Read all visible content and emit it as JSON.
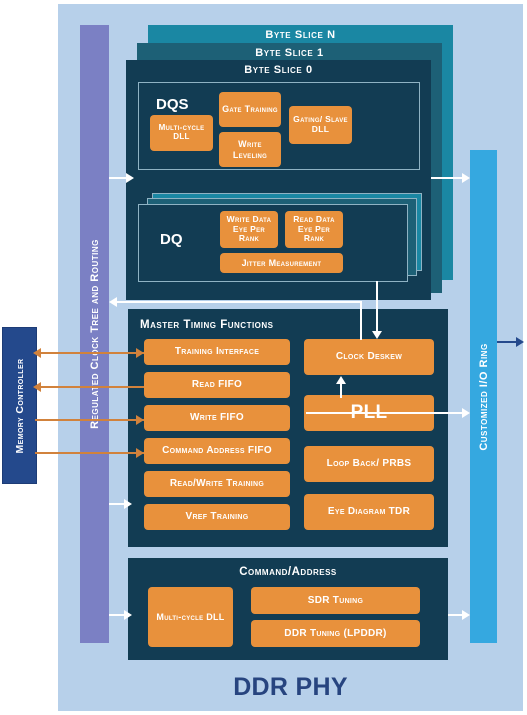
{
  "diagram": {
    "title": "DDR PHY",
    "external_block": {
      "label": "Memory Controller"
    },
    "left_bar": {
      "label": "Regulated Clock Tree and Routing"
    },
    "right_bar": {
      "label": "Customized I/O Ring"
    }
  },
  "colors": {
    "background": "#b7d0ea",
    "orange": "#e8913c",
    "dark_navy": "#123c53",
    "slice_n_teal": "#1a87a3",
    "slice_1_teal": "#1d6076",
    "clock_tree_purple": "#7b80c4",
    "io_ring_blue": "#35a8e0",
    "memory_controller_blue": "#24498c",
    "title_blue": "#27447f",
    "arrow_white": "#ffffff",
    "arrow_orange": "#d1823c"
  },
  "byte_slices": {
    "slice_n_label": "Byte Slice  N",
    "slice_1_label": "Byte Slice  1",
    "slice_0_label": "Byte Slice 0",
    "dqs": {
      "title": "DQS",
      "blocks": [
        {
          "label": "Multi-cycle DLL"
        },
        {
          "label": "Gate Training"
        },
        {
          "label": "Write Leveling"
        },
        {
          "label": "Gating/ Slave DLL"
        }
      ]
    },
    "dq": {
      "title": "DQ",
      "blocks": [
        {
          "label": "Write Data Eye Per Rank"
        },
        {
          "label": "Read Data Eye Per Rank"
        },
        {
          "label": "Jitter Measurement"
        }
      ]
    }
  },
  "master_timing": {
    "title": "Master Timing Functions",
    "left_blocks": [
      {
        "label": "Training Interface"
      },
      {
        "label": "Read FIFO"
      },
      {
        "label": "Write FIFO"
      },
      {
        "label": "Command Address FIFO"
      },
      {
        "label": "Read/Write Training"
      },
      {
        "label": "Vref Training"
      }
    ],
    "right_blocks": [
      {
        "label": "Clock Deskew"
      },
      {
        "label": "PLL"
      },
      {
        "label": "Loop Back/ PRBS"
      },
      {
        "label": "Eye Diagram TDR"
      }
    ]
  },
  "command_address": {
    "title": "Command/Address",
    "blocks": [
      {
        "label": "Multi-cycle DLL"
      },
      {
        "label": "SDR Tuning"
      },
      {
        "label": "DDR Tuning (LPDDR)"
      }
    ]
  }
}
